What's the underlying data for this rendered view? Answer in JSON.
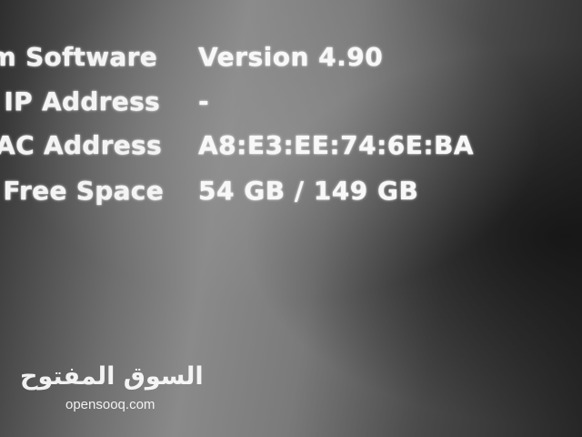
{
  "system_info": {
    "rows": [
      {
        "label": "em Software",
        "value": "Version 4.90"
      },
      {
        "label": "IP Address",
        "value": "-"
      },
      {
        "label": "MAC Address",
        "value": "A8:E3:EE:74:6E:BA"
      },
      {
        "label": "Free Space",
        "value": "54 GB / 149 GB"
      }
    ]
  },
  "watermark": {
    "arabic": "السوق المفتوح",
    "latin": "opensooq.com"
  }
}
